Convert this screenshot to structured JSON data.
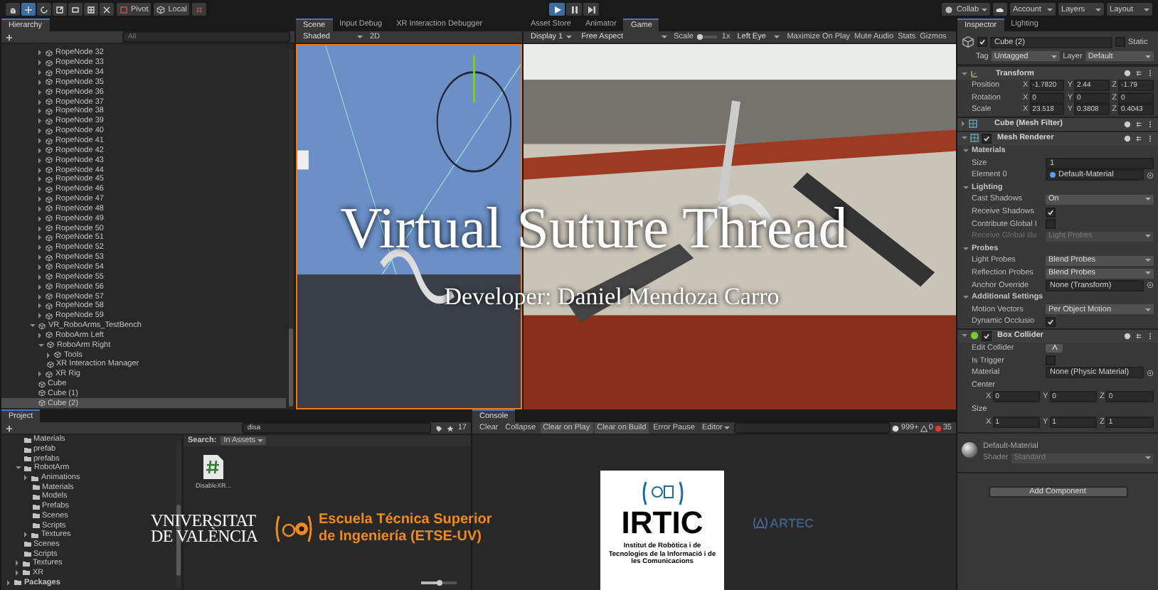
{
  "toolbar": {
    "pivot": "Pivot",
    "local": "Local",
    "playback": [
      {
        "kind": "play",
        "selected": true
      },
      {
        "kind": "pause",
        "selected": false
      },
      {
        "kind": "step",
        "selected": false
      }
    ],
    "collab": "Collab",
    "account": "Account",
    "layers": "Layers",
    "layout": "Layout"
  },
  "hierarchy": {
    "title": "Hierarchy",
    "search": {
      "placeholder": "All"
    },
    "partial_children": [
      {
        "label": "RopeNode 32",
        "expanded": false,
        "selected": false
      },
      {
        "label": "RopeNode 33",
        "expanded": false,
        "selected": false
      },
      {
        "label": "RopeNode 34",
        "expanded": false,
        "selected": false
      },
      {
        "label": "RopeNode 35",
        "expanded": false,
        "selected": false
      },
      {
        "label": "RopeNode 36",
        "expanded": false,
        "selected": false
      },
      {
        "label": "RopeNode 37",
        "expanded": false,
        "selected": false
      },
      {
        "label": "RopeNode 38",
        "expanded": false,
        "selected": false
      },
      {
        "label": "RopeNode 39",
        "expanded": false,
        "selected": false
      },
      {
        "label": "RopeNode 40",
        "expanded": false,
        "selected": false
      },
      {
        "label": "RopeNode 41",
        "expanded": false,
        "selected": false
      },
      {
        "label": "RopeNode 42",
        "expanded": false,
        "selected": false
      },
      {
        "label": "RopeNode 43",
        "expanded": false,
        "selected": false
      },
      {
        "label": "RopeNode 44",
        "expanded": false,
        "selected": false
      },
      {
        "label": "RopeNode 45",
        "expanded": false,
        "selected": false
      },
      {
        "label": "RopeNode 46",
        "expanded": false,
        "selected": false
      },
      {
        "label": "RopeNode 47",
        "expanded": false,
        "selected": false
      },
      {
        "label": "RopeNode 48",
        "expanded": false,
        "selected": false
      },
      {
        "label": "RopeNode 49",
        "expanded": false,
        "selected": false
      },
      {
        "label": "RopeNode 50",
        "expanded": false,
        "selected": false
      },
      {
        "label": "RopeNode 51",
        "expanded": false,
        "selected": false
      },
      {
        "label": "RopeNode 52",
        "expanded": false,
        "selected": false
      },
      {
        "label": "RopeNode 53",
        "expanded": false,
        "selected": false
      },
      {
        "label": "RopeNode 54",
        "expanded": false,
        "selected": false
      },
      {
        "label": "RopeNode 55",
        "expanded": false,
        "selected": false
      },
      {
        "label": "RopeNode 56",
        "expanded": false,
        "selected": false
      },
      {
        "label": "RopeNode 57",
        "expanded": false,
        "selected": false
      },
      {
        "label": "RopeNode 58",
        "expanded": false,
        "selected": false
      },
      {
        "label": "RopeNode 59",
        "expanded": false,
        "selected": false
      }
    ],
    "items": [
      {
        "label": "VR_RoboArms_TestBench",
        "expanded": true,
        "selected": false,
        "children": [
          {
            "label": "RoboArm Left",
            "expanded": false,
            "selected": false
          },
          {
            "label": "RoboArm Right",
            "expanded": true,
            "selected": false,
            "children": [
              {
                "label": "Tools",
                "expanded": false,
                "selected": false
              }
            ]
          },
          {
            "label": "XR Interaction Manager",
            "selected": false
          },
          {
            "label": "XR Rig",
            "expanded": false,
            "selected": false
          }
        ]
      },
      {
        "label": "Cube",
        "selected": false
      },
      {
        "label": "Cube (1)",
        "selected": false
      },
      {
        "label": "Cube (2)",
        "selected": true
      }
    ]
  },
  "scene": {
    "tabs": [
      {
        "label": "Scene",
        "selected": true
      },
      {
        "label": "Input Debug",
        "selected": false
      },
      {
        "label": "XR Interaction Debugger",
        "selected": false
      }
    ],
    "shading": "Shaded",
    "mode_2d": "2D"
  },
  "game": {
    "tabs": [
      {
        "label": "Asset Store",
        "selected": false
      },
      {
        "label": "Animator",
        "selected": false
      },
      {
        "label": "Game",
        "selected": true
      }
    ],
    "display": "Display 1",
    "aspect": "Free Aspect",
    "scale_label": "Scale",
    "scale_slider": {
      "level": 0.1
    },
    "scale_value": "1x",
    "eye": "Left Eye",
    "toggles": [
      "Maximize On Play",
      "Mute Audio",
      "Stats",
      "Gizmos"
    ]
  },
  "overlay": {
    "title": "Virtual Suture Thread",
    "developer": "Developer: Daniel Mendoza Carro"
  },
  "inspector": {
    "tabs": [
      {
        "label": "Inspector",
        "selected": true
      },
      {
        "label": "Lighting",
        "selected": false
      }
    ],
    "object": {
      "active": true,
      "name": "Cube (2)",
      "static_checked": false,
      "static": "Static",
      "tag_label": "Tag",
      "tag": "Untagged",
      "layer_label": "Layer",
      "layer": "Default"
    },
    "components": [
      {
        "kind": "transform",
        "title": "Transform",
        "expanded": true,
        "rows": [
          {
            "kind": "vector3",
            "label": "Position",
            "fields": [
              {
                "axis": "X",
                "value": "-1.7820"
              },
              {
                "axis": "Y",
                "value": "2.44"
              },
              {
                "axis": "Z",
                "value": "-1.79"
              }
            ]
          },
          {
            "kind": "vector3",
            "label": "Rotation",
            "fields": [
              {
                "axis": "X",
                "value": "0"
              },
              {
                "axis": "Y",
                "value": "0"
              },
              {
                "axis": "Z",
                "value": "0"
              }
            ]
          },
          {
            "kind": "vector3",
            "label": "Scale",
            "fields": [
              {
                "axis": "X",
                "value": "23.518"
              },
              {
                "axis": "Y",
                "value": "0.3808"
              },
              {
                "axis": "Z",
                "value": "0.4043"
              }
            ]
          }
        ]
      },
      {
        "kind": "mesh-filter",
        "title": "Cube (Mesh Filter)",
        "expanded": false
      },
      {
        "kind": "mesh-renderer",
        "title": "Mesh Renderer",
        "enabled": true,
        "expanded": true,
        "rows": [
          {
            "kind": "section",
            "label": "Materials",
            "expanded": true
          },
          {
            "kind": "field",
            "label": "Size",
            "value": "1"
          },
          {
            "kind": "material",
            "label": "Element 0",
            "value": "Default-Material"
          },
          {
            "kind": "section",
            "label": "Lighting",
            "expanded": true
          },
          {
            "kind": "dropdown",
            "label": "Cast Shadows",
            "value": "On",
            "disabled": false
          },
          {
            "kind": "checkbox",
            "label": "Receive Shadows",
            "checked": true
          },
          {
            "kind": "checkbox",
            "label": "Contribute Global I",
            "checked": false
          },
          {
            "kind": "dropdown",
            "label": "Receive Global Illu",
            "value": "Light Probes",
            "disabled": true
          },
          {
            "kind": "section",
            "label": "Probes",
            "expanded": true
          },
          {
            "kind": "dropdown",
            "label": "Light Probes",
            "value": "Blend Probes",
            "disabled": false
          },
          {
            "kind": "dropdown",
            "label": "Reflection Probes",
            "value": "Blend Probes",
            "disabled": false
          },
          {
            "kind": "object",
            "label": "Anchor Override",
            "value": "None (Transform)"
          },
          {
            "kind": "section",
            "label": "Additional Settings",
            "expanded": true
          },
          {
            "kind": "dropdown",
            "label": "Motion Vectors",
            "value": "Per Object Motion",
            "disabled": false
          },
          {
            "kind": "checkbox",
            "label": "Dynamic Occlusio",
            "checked": true
          }
        ]
      },
      {
        "kind": "box-collider",
        "title": "Box Collider",
        "enabled": true,
        "expanded": true,
        "rows": [
          {
            "kind": "edit",
            "label": "Edit Collider"
          },
          {
            "kind": "checkbox",
            "label": "Is Trigger",
            "checked": false
          },
          {
            "kind": "object",
            "label": "Material",
            "value": "None (Physic Material)"
          },
          {
            "kind": "heading",
            "label": "Center"
          },
          {
            "kind": "vector3",
            "fields": [
              {
                "axis": "X",
                "value": "0"
              },
              {
                "axis": "Y",
                "value": "0"
              },
              {
                "axis": "Z",
                "value": "0"
              }
            ]
          },
          {
            "kind": "heading",
            "label": "Size"
          },
          {
            "kind": "vector3",
            "fields": [
              {
                "axis": "X",
                "value": "1"
              },
              {
                "axis": "Y",
                "value": "1"
              },
              {
                "axis": "Z",
                "value": "1"
              }
            ]
          }
        ]
      }
    ],
    "material": {
      "name": "Default-Material",
      "shader_label": "Shader",
      "shader": "Standard"
    },
    "add_component": "Add Component"
  },
  "project": {
    "title": "Project",
    "search": {
      "value": "disa"
    },
    "count": "17",
    "partial_children": [
      {
        "label": "Materials",
        "selected": false
      },
      {
        "label": "prefab",
        "selected": false
      },
      {
        "label": "prefabs",
        "selected": false
      },
      {
        "label": "RobotArm",
        "expanded": true,
        "selected": false,
        "children": [
          {
            "label": "Animations",
            "expanded": false,
            "selected": false
          },
          {
            "label": "Materials",
            "selected": false
          },
          {
            "label": "Models",
            "selected": false
          },
          {
            "label": "Prefabs",
            "selected": false
          },
          {
            "label": "Scenes",
            "selected": false
          },
          {
            "label": "Scripts",
            "selected": false
          },
          {
            "label": "Textures",
            "expanded": false,
            "selected": false
          }
        ]
      },
      {
        "label": "Scenes",
        "selected": false
      },
      {
        "label": "Scripts",
        "selected": false
      },
      {
        "label": "Textures",
        "expanded": false,
        "selected": false
      },
      {
        "label": "XR",
        "expanded": false,
        "selected": false
      }
    ],
    "items": [
      {
        "label": "Packages",
        "expanded": false,
        "selected": false
      }
    ],
    "search_label": "Search:",
    "scope": "In Assets",
    "assets": [
      {
        "name": "DisableXR...",
        "selected": false
      }
    ],
    "zoom_slider": {
      "level": 0.5
    }
  },
  "console": {
    "title": "Console",
    "buttons": [
      {
        "label": "Clear",
        "selected": false
      },
      {
        "label": "Collapse",
        "selected": false
      },
      {
        "label": "Clear on Play",
        "selected": true
      },
      {
        "label": "Clear on Build",
        "selected": true
      },
      {
        "label": "Error Pause",
        "selected": false
      }
    ],
    "filter": "Editor",
    "counts": [
      {
        "kind": "info",
        "value": "999+"
      },
      {
        "kind": "warning",
        "value": "0"
      },
      {
        "kind": "error",
        "value": "35"
      }
    ]
  },
  "logos": {
    "uv": [
      "VNIVERSITAT",
      "DE VALÈNCIA"
    ],
    "etse": [
      "Escuela Técnica Superior",
      "de Ingeniería (ETSE-UV)"
    ],
    "irtic": {
      "name": "IRTIC",
      "subtitle": "Institut de Robòtica i de Tecnologies de la Informació i de les Comunicacions"
    },
    "artec": "ARTEC"
  }
}
